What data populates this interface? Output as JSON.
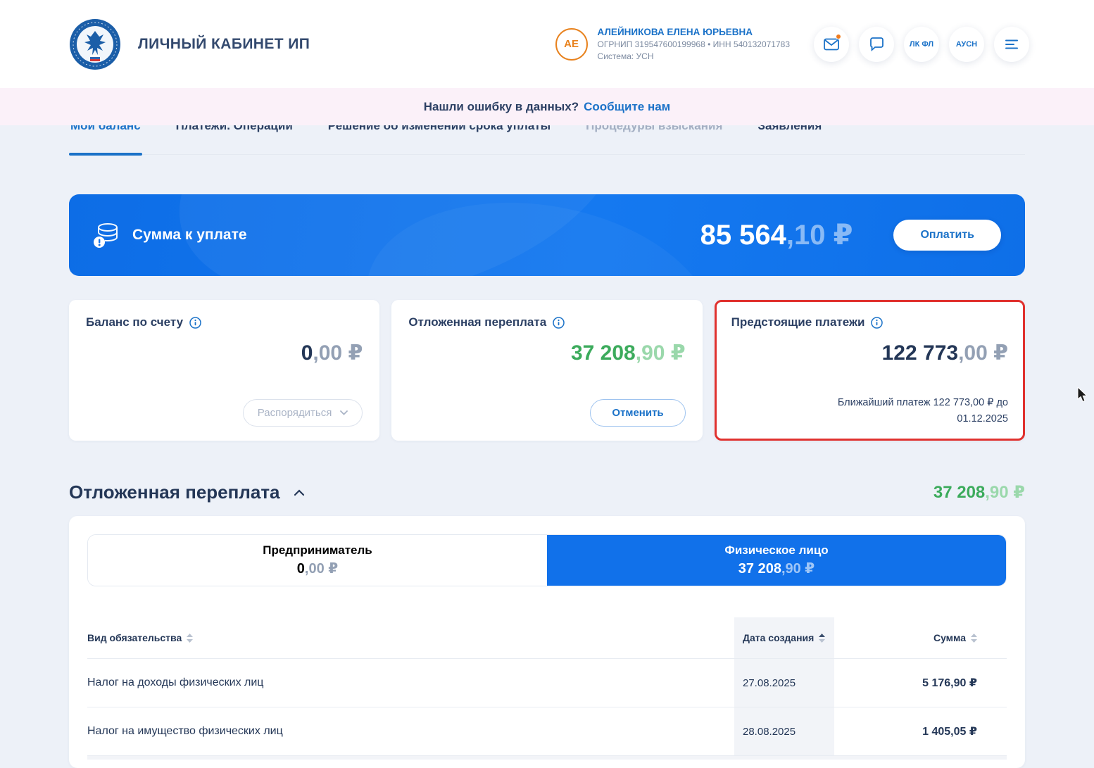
{
  "colors": {
    "accent_blue": "#1171ea",
    "link_blue": "#1b72c8",
    "green": "#3cab5c",
    "highlight_red": "#e0312e",
    "notice_bg": "#fbf1f9",
    "page_bg": "#edf1f8",
    "avatar_orange": "#e8821e"
  },
  "icons": {
    "logo": "fns-emblem",
    "mail": "envelope-with-dot",
    "chat": "speech-bubble",
    "menu": "hamburger-lines",
    "coins": "coin-stack-exclamation",
    "info": "circled-i",
    "chevron_down": "⌄",
    "chevron_up": "⌃",
    "sort": "⇅",
    "cursor": "arrow-pointer"
  },
  "header": {
    "title": "ЛИЧНЫЙ КАБИНЕТ ИП",
    "user": {
      "initials": "АЕ",
      "name": "АЛЕЙНИКОВА ЕЛЕНА ЮРЬЕВНА",
      "ids": "ОГРНИП 319547600199968  •  ИНН 540132071783",
      "system": "Система: УСН"
    },
    "actions": {
      "lk_fl": "ЛК ФЛ",
      "ausn": "АУСН"
    }
  },
  "notice": {
    "text": "Нашли ошибку в данных?",
    "link": "Сообщите нам"
  },
  "tabs": [
    {
      "label": "Мой баланс"
    },
    {
      "label": "Платежи. Операции"
    },
    {
      "label": "Решение об изменении срока уплаты"
    },
    {
      "label": "Процедуры взыскания"
    },
    {
      "label": "Заявления"
    }
  ],
  "banner": {
    "label": "Сумма к уплате",
    "amount_main": "85 564",
    "amount_frac": ",10 ₽",
    "pay": "Оплатить"
  },
  "cards": [
    {
      "title": "Баланс по счету",
      "amount_main": "0",
      "amount_frac": ",00 ₽",
      "button": "Распорядиться"
    },
    {
      "title": "Отложенная переплата",
      "amount_main": "37 208",
      "amount_frac": ",90 ₽",
      "button": "Отменить"
    },
    {
      "title": "Предстоящие платежи",
      "amount_main": "122 773",
      "amount_frac": ",00 ₽",
      "note": "Ближайший платеж 122 773,00 ₽ до 01.12.2025"
    }
  ],
  "section": {
    "title": "Отложенная переплата",
    "amount_main": "37 208",
    "amount_frac": ",90 ₽"
  },
  "toggle": {
    "left": {
      "label": "Предприниматель",
      "amount_main": "0",
      "amount_frac": ",00 ₽"
    },
    "right": {
      "label": "Физическое лицо",
      "amount_main": "37 208",
      "amount_frac": ",90 ₽"
    }
  },
  "table": {
    "headers": [
      "Вид обязательства",
      "Дата создания",
      "Сумма"
    ],
    "rows": [
      {
        "name": "Налог на доходы физических лиц",
        "date": "27.08.2025",
        "amount": "5 176,90 ₽"
      },
      {
        "name": "Налог на имущество физических лиц",
        "date": "28.08.2025",
        "amount": "1 405,05 ₽"
      }
    ]
  }
}
